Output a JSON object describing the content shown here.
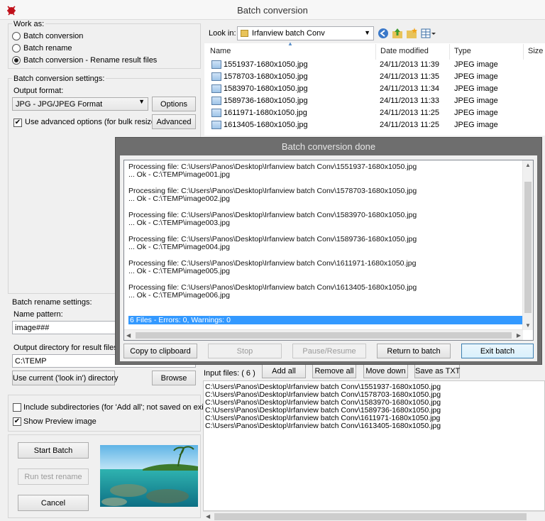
{
  "window": {
    "title": "Batch conversion"
  },
  "work_as": {
    "heading": "Work as:",
    "options": [
      {
        "label": "Batch conversion",
        "selected": false
      },
      {
        "label": "Batch rename",
        "selected": false
      },
      {
        "label": "Batch conversion - Rename result files",
        "selected": true
      }
    ]
  },
  "conversion": {
    "heading": "Batch conversion settings:",
    "output_format_label": "Output format:",
    "output_format_value": "JPG - JPG/JPEG Format",
    "options_button": "Options",
    "advanced_checkbox": "Use advanced options (for bulk resize...)",
    "advanced_checked": true,
    "advanced_button": "Advanced"
  },
  "rename": {
    "heading": "Batch rename settings:",
    "name_pattern_label": "Name pattern:",
    "name_pattern_value": "image###"
  },
  "output": {
    "label": "Output directory for result files:",
    "value": "C:\\TEMP",
    "use_current_button": "Use current ('look in') directory",
    "browse_button": "Browse"
  },
  "options": {
    "include_subdirs": "Include subdirectories (for 'Add all'; not saved on exit)",
    "include_subdirs_checked": false,
    "show_preview": "Show Preview image",
    "show_preview_checked": true
  },
  "actions": {
    "start": "Start Batch",
    "run_test": "Run test rename",
    "cancel": "Cancel"
  },
  "browser": {
    "look_in_label": "Look in:",
    "look_in_value": "Irfanview batch Conv",
    "columns": [
      "Name",
      "Date modified",
      "Type",
      "Size"
    ],
    "files": [
      {
        "name": "1551937-1680x1050.jpg",
        "date": "24/11/2013 11:39",
        "type": "JPEG image"
      },
      {
        "name": "1578703-1680x1050.jpg",
        "date": "24/11/2013 11:35",
        "type": "JPEG image"
      },
      {
        "name": "1583970-1680x1050.jpg",
        "date": "24/11/2013 11:34",
        "type": "JPEG image"
      },
      {
        "name": "1589736-1680x1050.jpg",
        "date": "24/11/2013 11:33",
        "type": "JPEG image"
      },
      {
        "name": "1611971-1680x1050.jpg",
        "date": "24/11/2013 11:25",
        "type": "JPEG image"
      },
      {
        "name": "1613405-1680x1050.jpg",
        "date": "24/11/2013 11:25",
        "type": "JPEG image"
      }
    ]
  },
  "dialog": {
    "title": "Batch conversion done",
    "log": [
      {
        "processing": "Processing file: C:\\Users\\Panos\\Desktop\\Irfanview batch Conv\\1551937-1680x1050.jpg",
        "ok": "... Ok - C:\\TEMP\\image001.jpg"
      },
      {
        "processing": "Processing file: C:\\Users\\Panos\\Desktop\\Irfanview batch Conv\\1578703-1680x1050.jpg",
        "ok": "... Ok - C:\\TEMP\\image002.jpg"
      },
      {
        "processing": "Processing file: C:\\Users\\Panos\\Desktop\\Irfanview batch Conv\\1583970-1680x1050.jpg",
        "ok": "... Ok - C:\\TEMP\\image003.jpg"
      },
      {
        "processing": "Processing file: C:\\Users\\Panos\\Desktop\\Irfanview batch Conv\\1589736-1680x1050.jpg",
        "ok": "... Ok - C:\\TEMP\\image004.jpg"
      },
      {
        "processing": "Processing file: C:\\Users\\Panos\\Desktop\\Irfanview batch Conv\\1611971-1680x1050.jpg",
        "ok": "... Ok - C:\\TEMP\\image005.jpg"
      },
      {
        "processing": "Processing file: C:\\Users\\Panos\\Desktop\\Irfanview batch Conv\\1613405-1680x1050.jpg",
        "ok": "... Ok - C:\\TEMP\\image006.jpg"
      }
    ],
    "summary": "6 Files - Errors: 0, Warnings: 0",
    "buttons": {
      "copy": "Copy to clipboard",
      "stop": "Stop",
      "pause": "Pause/Resume",
      "return": "Return to batch",
      "exit": "Exit batch"
    }
  },
  "input_files": {
    "label": "Input files: ( 6 )",
    "add_all": "Add all",
    "remove_all": "Remove all",
    "move_down": "Move down",
    "save_txt": "Save as TXT",
    "items": [
      "C:\\Users\\Panos\\Desktop\\Irfanview batch Conv\\1551937-1680x1050.jpg",
      "C:\\Users\\Panos\\Desktop\\Irfanview batch Conv\\1578703-1680x1050.jpg",
      "C:\\Users\\Panos\\Desktop\\Irfanview batch Conv\\1583970-1680x1050.jpg",
      "C:\\Users\\Panos\\Desktop\\Irfanview batch Conv\\1589736-1680x1050.jpg",
      "C:\\Users\\Panos\\Desktop\\Irfanview batch Conv\\1611971-1680x1050.jpg",
      "C:\\Users\\Panos\\Desktop\\Irfanview batch Conv\\1613405-1680x1050.jpg"
    ]
  },
  "colors": {
    "selection": "#3399ff",
    "dialog_frame": "#6e6e6e"
  }
}
